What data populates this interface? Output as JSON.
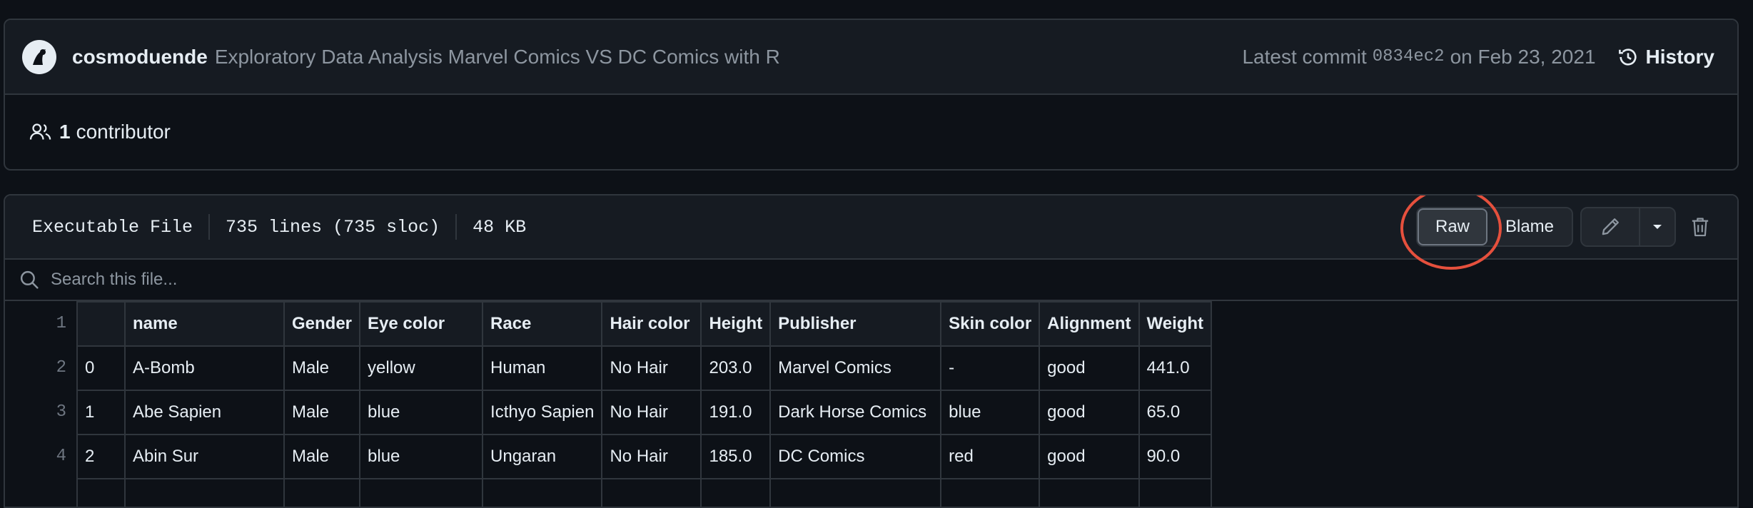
{
  "commit": {
    "author": "cosmoduende",
    "message": "Exploratory Data Analysis Marvel Comics VS DC Comics with R",
    "latest_label": "Latest commit",
    "sha": "0834ec2",
    "date_text": "on Feb 23, 2021",
    "history_label": "History"
  },
  "contributors": {
    "count": "1",
    "label": "contributor"
  },
  "file": {
    "mode": "Executable File",
    "lines": "735 lines (735 sloc)",
    "size": "48 KB",
    "raw_label": "Raw",
    "blame_label": "Blame"
  },
  "search": {
    "placeholder": "Search this file..."
  },
  "table": {
    "line_numbers": [
      "1",
      "2",
      "3",
      "4"
    ],
    "headers": [
      "",
      "name",
      "Gender",
      "Eye color",
      "Race",
      "Hair color",
      "Height",
      "Publisher",
      "Skin color",
      "Alignment",
      "Weight"
    ],
    "rows": [
      [
        "0",
        "A-Bomb",
        "Male",
        "yellow",
        "Human",
        "No Hair",
        "203.0",
        "Marvel Comics",
        "-",
        "good",
        "441.0"
      ],
      [
        "1",
        "Abe Sapien",
        "Male",
        "blue",
        "Icthyo Sapien",
        "No Hair",
        "191.0",
        "Dark Horse Comics",
        "blue",
        "good",
        "65.0"
      ],
      [
        "2",
        "Abin Sur",
        "Male",
        "blue",
        "Ungaran",
        "No Hair",
        "185.0",
        "DC Comics",
        "red",
        "good",
        "90.0"
      ],
      [
        "",
        "",
        "",
        "",
        "",
        "",
        "",
        "",
        "",
        "",
        ""
      ]
    ]
  },
  "colors": {
    "background": "#0d1117",
    "border": "#30363d",
    "highlight_circle": "#e5503d"
  }
}
